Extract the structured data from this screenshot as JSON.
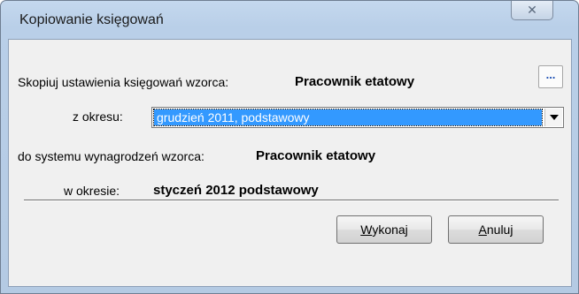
{
  "window": {
    "title": "Kopiowanie księgowań",
    "close_glyph": "✕"
  },
  "form": {
    "copy_label": "Skopiuj ustawienia księgowań wzorca:",
    "copy_value": "Pracownik etatowy",
    "ellipsis_label": "...",
    "from_period_label": "z okresu:",
    "from_period_value": "grudzień 2011, podstawowy",
    "to_system_label": "do systemu wynagrodzeń wzorca:",
    "to_system_value": "Pracownik etatowy",
    "in_period_label": "w okresie:",
    "in_period_value": "styczeń 2012 podstawowy"
  },
  "buttons": {
    "execute_accel": "W",
    "execute_rest": "ykonaj",
    "cancel_accel": "A",
    "cancel_rest": "nuluj"
  },
  "colors": {
    "selection": "#3399ff",
    "titlebar": "#b9cfe8",
    "dialog_bg": "#f0f0f0"
  }
}
